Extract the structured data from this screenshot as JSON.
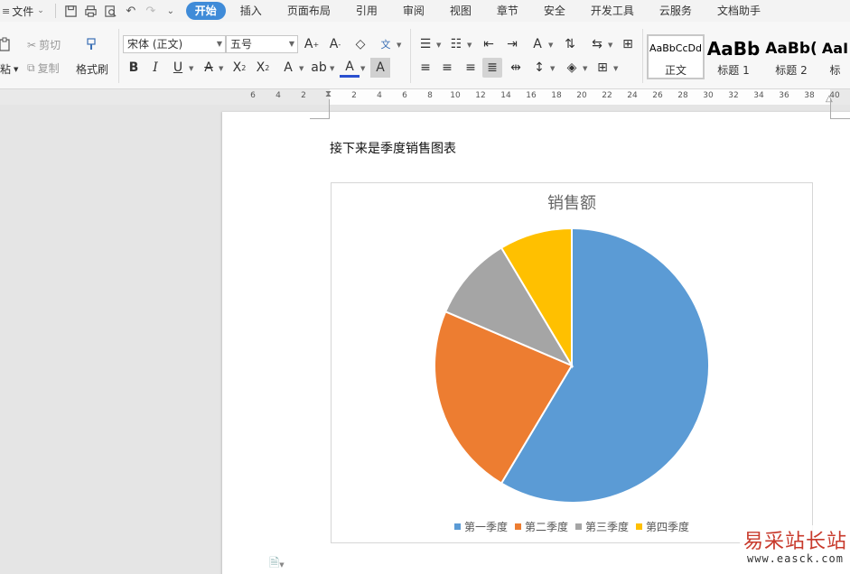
{
  "menubar": {
    "file_label": "文件",
    "tabs": [
      "开始",
      "插入",
      "页面布局",
      "引用",
      "审阅",
      "视图",
      "章节",
      "安全",
      "开发工具",
      "云服务",
      "文档助手"
    ],
    "active_tab": "开始"
  },
  "ribbon": {
    "clipboard": {
      "paste_label": "粘",
      "cut_label": "剪切",
      "copy_label": "复制",
      "format_painter_label": "格式刷"
    },
    "font_name": "宋体 (正文)",
    "font_size": "五号",
    "styles": [
      {
        "preview": "AaBbCcDd",
        "label": "正文"
      },
      {
        "preview": "AaBb",
        "label": "标题 1"
      },
      {
        "preview": "AaBb(",
        "label": "标题 2"
      },
      {
        "preview": "AaI",
        "label": "标"
      }
    ]
  },
  "ruler": {
    "labels": [
      "6",
      "4",
      "2",
      "2",
      "4",
      "6",
      "8",
      "10",
      "12",
      "14",
      "16",
      "18",
      "20",
      "22",
      "24",
      "26",
      "28",
      "30",
      "32",
      "34",
      "36",
      "38",
      "40"
    ]
  },
  "document": {
    "intro_text": "接下来是季度销售图表"
  },
  "chart_data": {
    "type": "pie",
    "title": "销售额",
    "categories": [
      "第一季度",
      "第二季度",
      "第三季度",
      "第四季度"
    ],
    "values": [
      8.2,
      3.2,
      1.4,
      1.2
    ],
    "colors": [
      "#5b9bd5",
      "#ed7d31",
      "#a5a5a5",
      "#ffc000"
    ],
    "legend_position": "bottom"
  },
  "watermark": {
    "title": "易采站长站",
    "url": "www.easck.com"
  }
}
